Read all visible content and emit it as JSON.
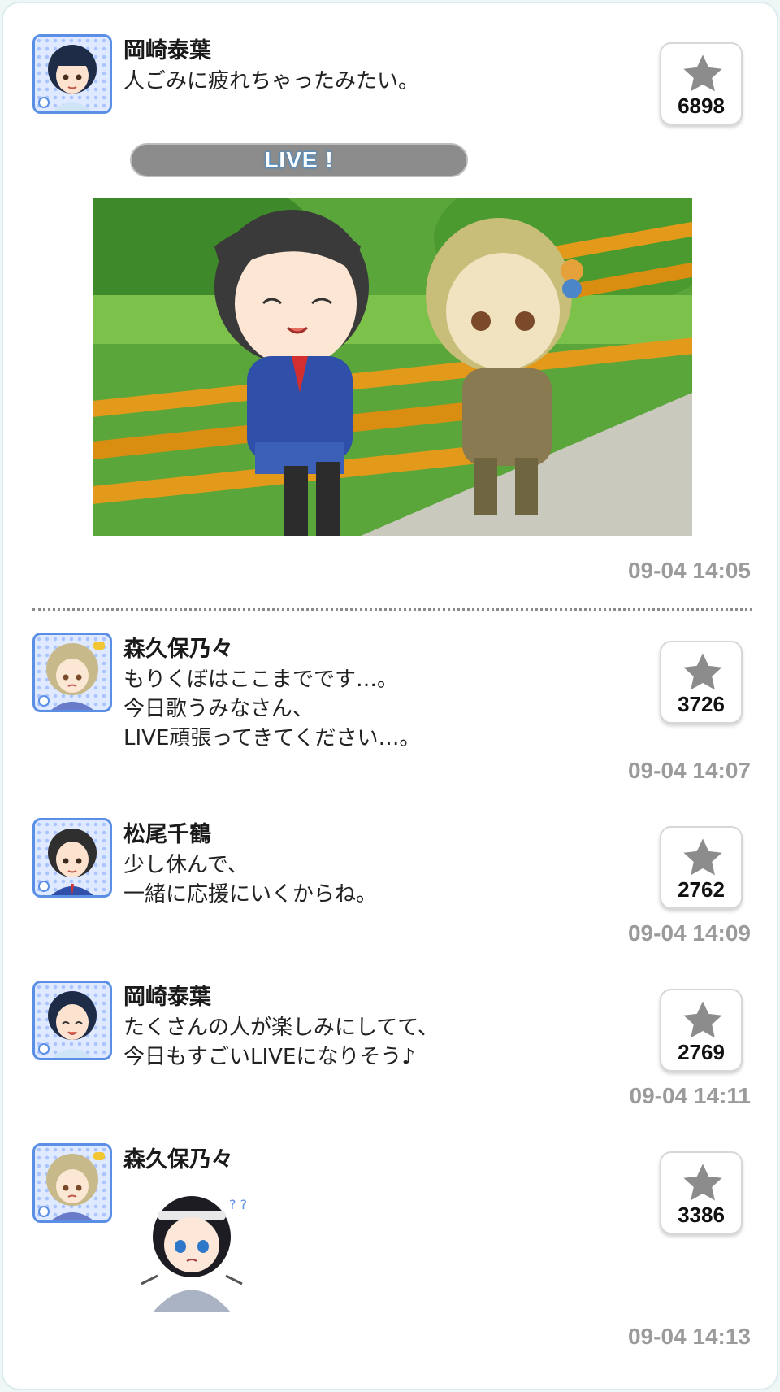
{
  "posts": [
    {
      "name": "岡崎泰葉",
      "message": "人ごみに疲れちゃったみたい。",
      "likes": "6898",
      "live_label": "LIVE !",
      "time": "09-04 14:05",
      "avatar_icon": "idol-avatar-icon"
    },
    {
      "name": "森久保乃々",
      "message": "もりくぼはここまでです…。\n今日歌うみなさん、\nLIVE頑張ってきてください…。",
      "likes": "3726",
      "time": "09-04 14:07",
      "avatar_icon": "idol-avatar-icon"
    },
    {
      "name": "松尾千鶴",
      "message": "少し休んで、\n一緒に応援にいくからね。",
      "likes": "2762",
      "time": "09-04 14:09",
      "avatar_icon": "idol-avatar-icon"
    },
    {
      "name": "岡崎泰葉",
      "message": "たくさんの人が楽しみにしてて、\n今日もすごいLIVEになりそう♪",
      "likes": "2769",
      "time": "09-04 14:11",
      "avatar_icon": "idol-avatar-icon"
    },
    {
      "name": "森久保乃々",
      "message": "",
      "likes": "3386",
      "time": "09-04 14:13",
      "avatar_icon": "idol-avatar-icon",
      "sticker_icon": "chibi-sticker-icon"
    }
  ],
  "colors": {
    "avatar_border": "#5b8fe6",
    "timestamp": "#9b9b9b",
    "live_bar": "#8c8c8c",
    "star": "#8c8c8c"
  }
}
